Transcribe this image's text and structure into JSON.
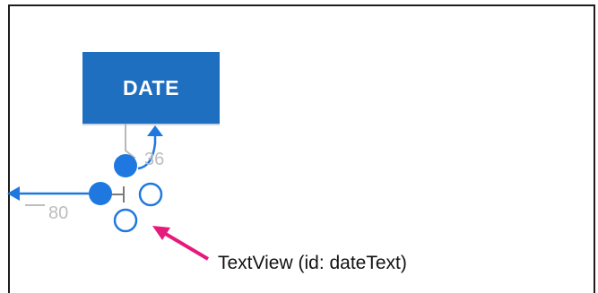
{
  "button": {
    "label": "DATE"
  },
  "constraints": {
    "top_margin": "36",
    "left_margin": "80"
  },
  "callout": {
    "label": "TextView (id: dateText)"
  },
  "colors": {
    "button": "#1f6fc0",
    "handle": "#1f78e0",
    "arrow": "#e6197d",
    "margin_text": "#bdbdbd"
  }
}
